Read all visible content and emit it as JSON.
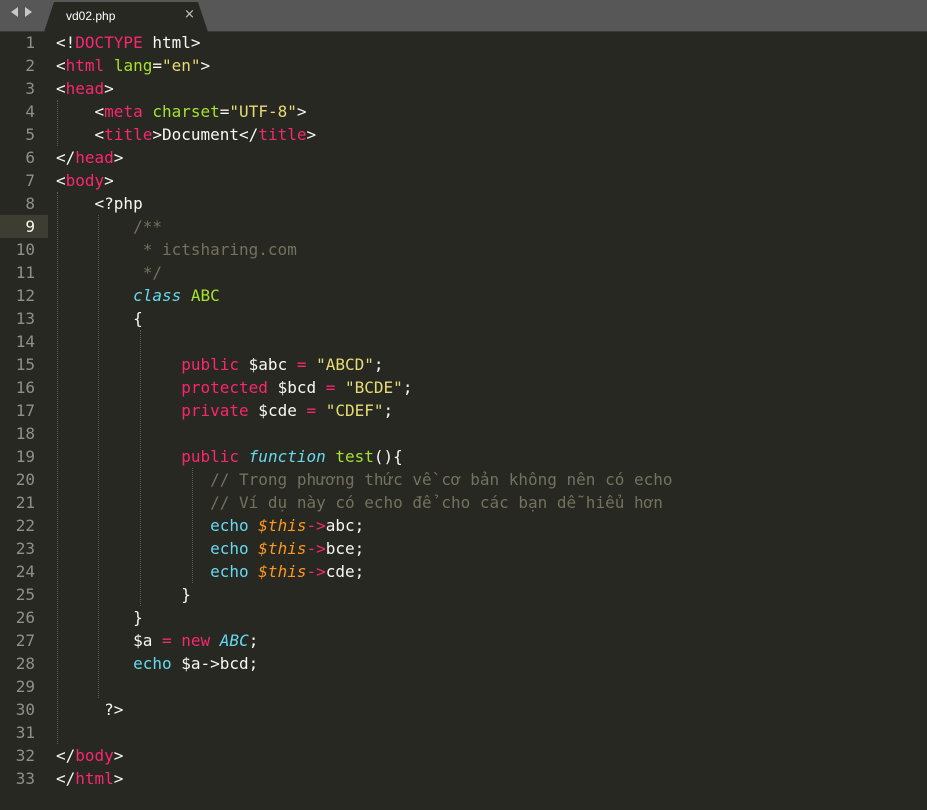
{
  "tab": {
    "title": "vd02.php",
    "close_glyph": "×"
  },
  "editor": {
    "current_line": 9
  },
  "lines": [
    [
      [
        "p",
        "<!"
      ],
      [
        "t",
        "DOCTYPE"
      ],
      [
        "p",
        " html>"
      ]
    ],
    [
      [
        "p",
        "<"
      ],
      [
        "t",
        "html"
      ],
      [
        "p",
        " "
      ],
      [
        "a",
        "lang"
      ],
      [
        "p",
        "="
      ],
      [
        "s",
        "\"en\""
      ],
      [
        "p",
        ">"
      ]
    ],
    [
      [
        "p",
        "<"
      ],
      [
        "t",
        "head"
      ],
      [
        "p",
        ">"
      ]
    ],
    [
      [
        "p",
        "    <"
      ],
      [
        "t",
        "meta"
      ],
      [
        "p",
        " "
      ],
      [
        "a",
        "charset"
      ],
      [
        "p",
        "="
      ],
      [
        "s",
        "\"UTF-8\""
      ],
      [
        "p",
        ">"
      ]
    ],
    [
      [
        "p",
        "    <"
      ],
      [
        "t",
        "title"
      ],
      [
        "p",
        ">Document</"
      ],
      [
        "t",
        "title"
      ],
      [
        "p",
        ">"
      ]
    ],
    [
      [
        "p",
        "</"
      ],
      [
        "t",
        "head"
      ],
      [
        "p",
        ">"
      ]
    ],
    [
      [
        "p",
        "<"
      ],
      [
        "t",
        "body"
      ],
      [
        "p",
        ">"
      ]
    ],
    [
      [
        "p",
        "    <?php"
      ]
    ],
    [
      [
        "c",
        "        /**"
      ]
    ],
    [
      [
        "c",
        "         * ictsharing.com"
      ]
    ],
    [
      [
        "c",
        "         */"
      ]
    ],
    [
      [
        "p",
        "        "
      ],
      [
        "k",
        "class"
      ],
      [
        "p",
        " "
      ],
      [
        "ty",
        "ABC"
      ]
    ],
    [
      [
        "p",
        "        {"
      ]
    ],
    [
      [
        "p",
        ""
      ]
    ],
    [
      [
        "p",
        "             "
      ],
      [
        "n",
        "public"
      ],
      [
        "p",
        " $abc "
      ],
      [
        "n",
        "="
      ],
      [
        "p",
        " "
      ],
      [
        "s",
        "\"ABCD\""
      ],
      [
        "p",
        ";"
      ]
    ],
    [
      [
        "p",
        "             "
      ],
      [
        "n",
        "protected"
      ],
      [
        "p",
        " $bcd "
      ],
      [
        "n",
        "="
      ],
      [
        "p",
        " "
      ],
      [
        "s",
        "\"BCDE\""
      ],
      [
        "p",
        ";"
      ]
    ],
    [
      [
        "p",
        "             "
      ],
      [
        "n",
        "private"
      ],
      [
        "p",
        " $cde "
      ],
      [
        "n",
        "="
      ],
      [
        "p",
        " "
      ],
      [
        "s",
        "\"CDEF\""
      ],
      [
        "p",
        ";"
      ]
    ],
    [
      [
        "p",
        ""
      ]
    ],
    [
      [
        "p",
        "             "
      ],
      [
        "n",
        "public"
      ],
      [
        "p",
        " "
      ],
      [
        "k",
        "function"
      ],
      [
        "p",
        " "
      ],
      [
        "a",
        "test"
      ],
      [
        "p",
        "(){"
      ]
    ],
    [
      [
        "c",
        "                // Trong phương thức về cơ bản không nên có echo"
      ]
    ],
    [
      [
        "c",
        "                // Ví dụ này có echo để cho các bạn dễ hiểu hơn"
      ]
    ],
    [
      [
        "p",
        "                "
      ],
      [
        "kw",
        "echo"
      ],
      [
        "p",
        " "
      ],
      [
        "v",
        "$this"
      ],
      [
        "n",
        "->"
      ],
      [
        "p",
        "abc;"
      ]
    ],
    [
      [
        "p",
        "                "
      ],
      [
        "kw",
        "echo"
      ],
      [
        "p",
        " "
      ],
      [
        "v",
        "$this"
      ],
      [
        "n",
        "->"
      ],
      [
        "p",
        "bce;"
      ]
    ],
    [
      [
        "p",
        "                "
      ],
      [
        "kw",
        "echo"
      ],
      [
        "p",
        " "
      ],
      [
        "v",
        "$this"
      ],
      [
        "n",
        "->"
      ],
      [
        "p",
        "cde;"
      ]
    ],
    [
      [
        "p",
        "             }"
      ]
    ],
    [
      [
        "p",
        "        }"
      ]
    ],
    [
      [
        "p",
        "        $a "
      ],
      [
        "n",
        "="
      ],
      [
        "p",
        " "
      ],
      [
        "n",
        "new"
      ],
      [
        "p",
        " "
      ],
      [
        "k",
        "ABC"
      ],
      [
        "p",
        ";"
      ]
    ],
    [
      [
        "p",
        "        "
      ],
      [
        "kw",
        "echo"
      ],
      [
        "p",
        " $a->bcd;"
      ]
    ],
    [
      [
        "p",
        ""
      ]
    ],
    [
      [
        "p",
        "     ?>"
      ]
    ],
    [
      [
        "p",
        ""
      ]
    ],
    [
      [
        "p",
        "</"
      ],
      [
        "t",
        "body"
      ],
      [
        "p",
        ">"
      ]
    ],
    [
      [
        "p",
        "</"
      ],
      [
        "t",
        "html"
      ],
      [
        "p",
        ">"
      ]
    ]
  ],
  "icons": {
    "nav_left": "chevron-left-icon",
    "nav_right": "chevron-right-icon",
    "close": "close-icon"
  }
}
